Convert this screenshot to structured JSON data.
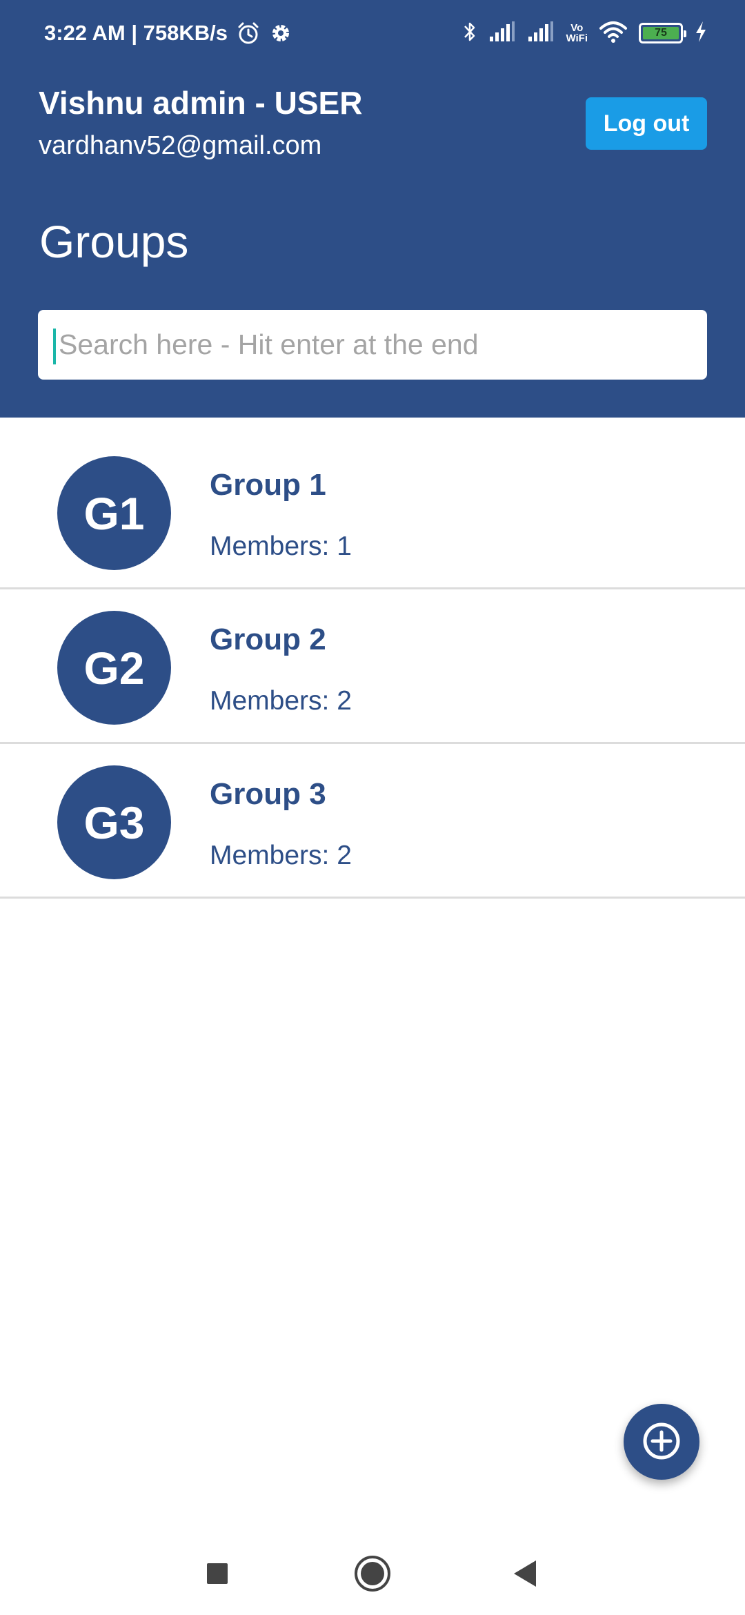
{
  "status_bar": {
    "time_speed": "3:22 AM | 758KB/s",
    "battery": "75",
    "volte_top": "Vo",
    "volte_bottom": "WiFi",
    "icons": [
      "alarm-icon",
      "gear-icon",
      "bluetooth-icon",
      "signal-icon",
      "signal-icon",
      "wifi-icon",
      "battery-icon",
      "charging-icon"
    ]
  },
  "header": {
    "user_name": "Vishnu admin - USER",
    "user_email": "vardhanv52@gmail.com",
    "logout_label": "Log out",
    "title": "Groups",
    "background_color": "#2d4e87",
    "logout_color": "#1a9ce6"
  },
  "search": {
    "value": "",
    "placeholder": "Search here - Hit enter at the end"
  },
  "groups": [
    {
      "initials": "G1",
      "name": "Group 1",
      "members": "Members: 1"
    },
    {
      "initials": "G2",
      "name": "Group 2",
      "members": "Members: 2"
    },
    {
      "initials": "G3",
      "name": "Group 3",
      "members": "Members: 2"
    }
  ],
  "fab": {
    "icon": "add-circle-icon"
  },
  "nav": {
    "icons": [
      "recents-icon",
      "home-icon",
      "back-icon"
    ]
  }
}
